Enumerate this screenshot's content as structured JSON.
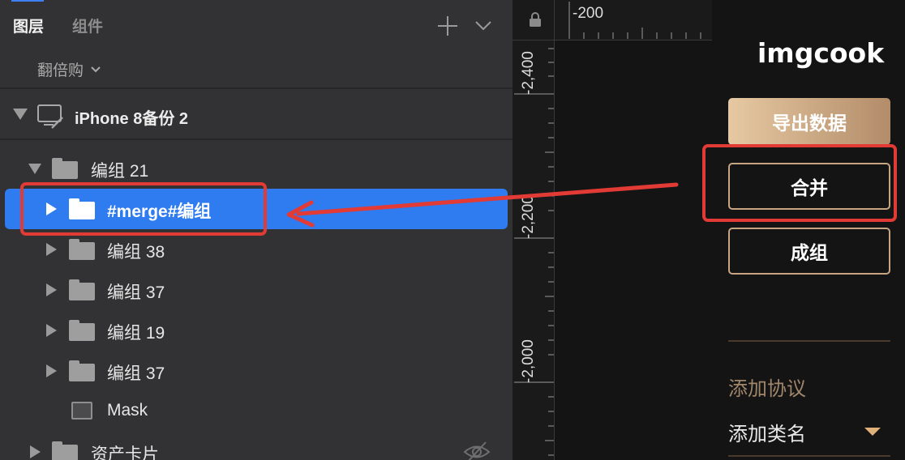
{
  "layers_panel": {
    "tabs": [
      {
        "label": "图层",
        "active": true
      },
      {
        "label": "组件",
        "active": false
      }
    ],
    "page_selector": "翻倍购",
    "artboard": "iPhone 8备份 2",
    "tree": [
      {
        "label": "编组 21",
        "indent": 1,
        "expanded": true,
        "icon": "folder-icon"
      },
      {
        "label": "#merge#编组",
        "indent": 2,
        "expanded": false,
        "selected": true,
        "icon": "folder-icon"
      },
      {
        "label": "编组 38",
        "indent": 2,
        "expanded": false,
        "icon": "folder-icon"
      },
      {
        "label": "编组 37",
        "indent": 2,
        "expanded": false,
        "icon": "folder-icon"
      },
      {
        "label": "编组 19",
        "indent": 2,
        "expanded": false,
        "icon": "folder-icon"
      },
      {
        "label": "编组 37",
        "indent": 2,
        "expanded": false,
        "icon": "folder-icon"
      },
      {
        "label": "Mask",
        "indent": 2,
        "icon": "mask-icon"
      },
      {
        "label": "资产卡片",
        "indent": 1,
        "expanded": false,
        "icon": "folder-icon",
        "hidden": true
      }
    ]
  },
  "canvas": {
    "ruler_top_label": "-200",
    "ruler_left_labels": [
      "-2,400",
      "-2,200",
      "-2,000"
    ]
  },
  "imgcook": {
    "logo": "imgcook",
    "export_button": "导出数据",
    "merge_button": "合并",
    "group_button": "成组",
    "protocol_heading": "添加协议",
    "classname_select": "添加类名"
  },
  "colors": {
    "selection": "#2f7bf0",
    "annotation_red": "#e23a35",
    "accent_gold": "#c8a582"
  }
}
